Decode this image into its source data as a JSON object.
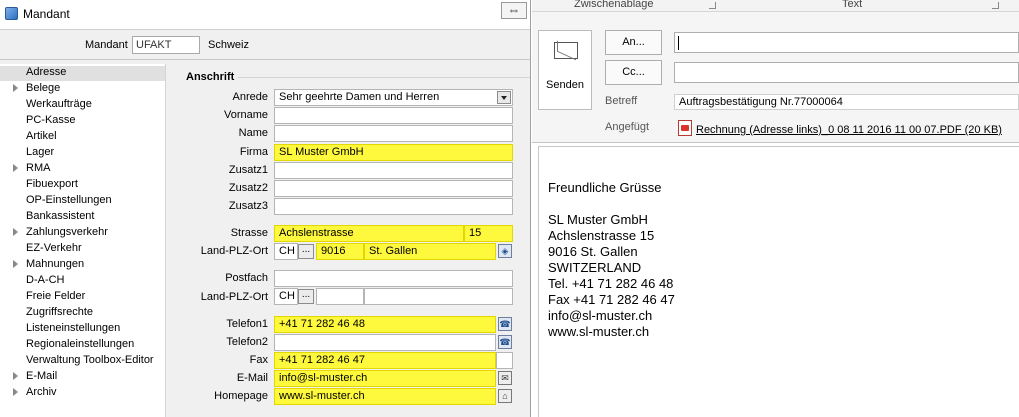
{
  "left_window": {
    "title": "Mandant",
    "swap_icon": "⇔",
    "mandant": {
      "label": "Mandant",
      "value": "UFAKT",
      "name": "Schweiz"
    },
    "sidebar": {
      "items": [
        {
          "label": "Adresse",
          "arrow": false
        },
        {
          "label": "Belege",
          "arrow": true
        },
        {
          "label": "Werkaufträge",
          "arrow": false
        },
        {
          "label": "PC-Kasse",
          "arrow": false
        },
        {
          "label": "Artikel",
          "arrow": false
        },
        {
          "label": "Lager",
          "arrow": false
        },
        {
          "label": "RMA",
          "arrow": true
        },
        {
          "label": "Fibuexport",
          "arrow": false
        },
        {
          "label": "OP-Einstellungen",
          "arrow": false
        },
        {
          "label": "Bankassistent",
          "arrow": false
        },
        {
          "label": "Zahlungsverkehr",
          "arrow": true
        },
        {
          "label": "EZ-Verkehr",
          "arrow": false
        },
        {
          "label": "Mahnungen",
          "arrow": true
        },
        {
          "label": "D-A-CH",
          "arrow": false
        },
        {
          "label": "Freie Felder",
          "arrow": false
        },
        {
          "label": "Zugriffsrechte",
          "arrow": false
        },
        {
          "label": "Listeneinstellungen",
          "arrow": false
        },
        {
          "label": "Regionaleinstellungen",
          "arrow": false
        },
        {
          "label": "Verwaltung Toolbox-Editor",
          "arrow": false
        },
        {
          "label": "E-Mail",
          "arrow": true
        },
        {
          "label": "Archiv",
          "arrow": true
        }
      ]
    },
    "form": {
      "section_title": "Anschrift",
      "anrede": {
        "label": "Anrede",
        "value": "Sehr geehrte Damen und Herren"
      },
      "vorname": {
        "label": "Vorname",
        "value": ""
      },
      "name": {
        "label": "Name",
        "value": ""
      },
      "firma": {
        "label": "Firma",
        "value": "SL Muster GmbH"
      },
      "zusatz1": {
        "label": "Zusatz1",
        "value": ""
      },
      "zusatz2": {
        "label": "Zusatz2",
        "value": ""
      },
      "zusatz3": {
        "label": "Zusatz3",
        "value": ""
      },
      "strasse": {
        "label": "Strasse",
        "value": "Achslenstrasse",
        "number": "15"
      },
      "land_plz_ort": {
        "label": "Land-PLZ-Ort",
        "land": "CH",
        "plz": "9016",
        "ort": "St. Gallen"
      },
      "postfach": {
        "label": "Postfach",
        "value": ""
      },
      "land_plz_ort2": {
        "label": "Land-PLZ-Ort",
        "land": "CH",
        "plz": "",
        "ort": ""
      },
      "telefon1": {
        "label": "Telefon1",
        "value": "+41 71 282 46 48"
      },
      "telefon2": {
        "label": "Telefon2",
        "value": ""
      },
      "fax": {
        "label": "Fax",
        "value": "+41 71 282 46 47"
      },
      "email": {
        "label": "E-Mail",
        "value": "info@sl-muster.ch"
      },
      "homepage": {
        "label": "Homepage",
        "value": "www.sl-muster.ch"
      },
      "dots_label": "..."
    }
  },
  "right_window": {
    "ribbon": {
      "group1": "Zwischenablage",
      "group2": "Text"
    },
    "send_label": "Senden",
    "to_button": "An...",
    "cc_button": "Cc...",
    "subject_label": "Betreff",
    "subject_value": "Auftragsbestätigung Nr.77000064",
    "attached_label": "Angefügt",
    "attachment": "Rechnung (Adresse links)_0 08 11 2016 11 00 07.PDF (20 KB)",
    "body_lines": [
      "Freundliche Grüsse",
      "",
      "SL Muster GmbH",
      "Achslenstrasse 15",
      "9016 St. Gallen",
      "SWITZERLAND",
      "Tel. +41 71 282 46 48",
      "Fax +41 71 282 46 47",
      "info@sl-muster.ch",
      "www.sl-muster.ch"
    ]
  },
  "colors": {
    "highlight": "#fef93c",
    "panel_bg": "#f0f0f0"
  }
}
